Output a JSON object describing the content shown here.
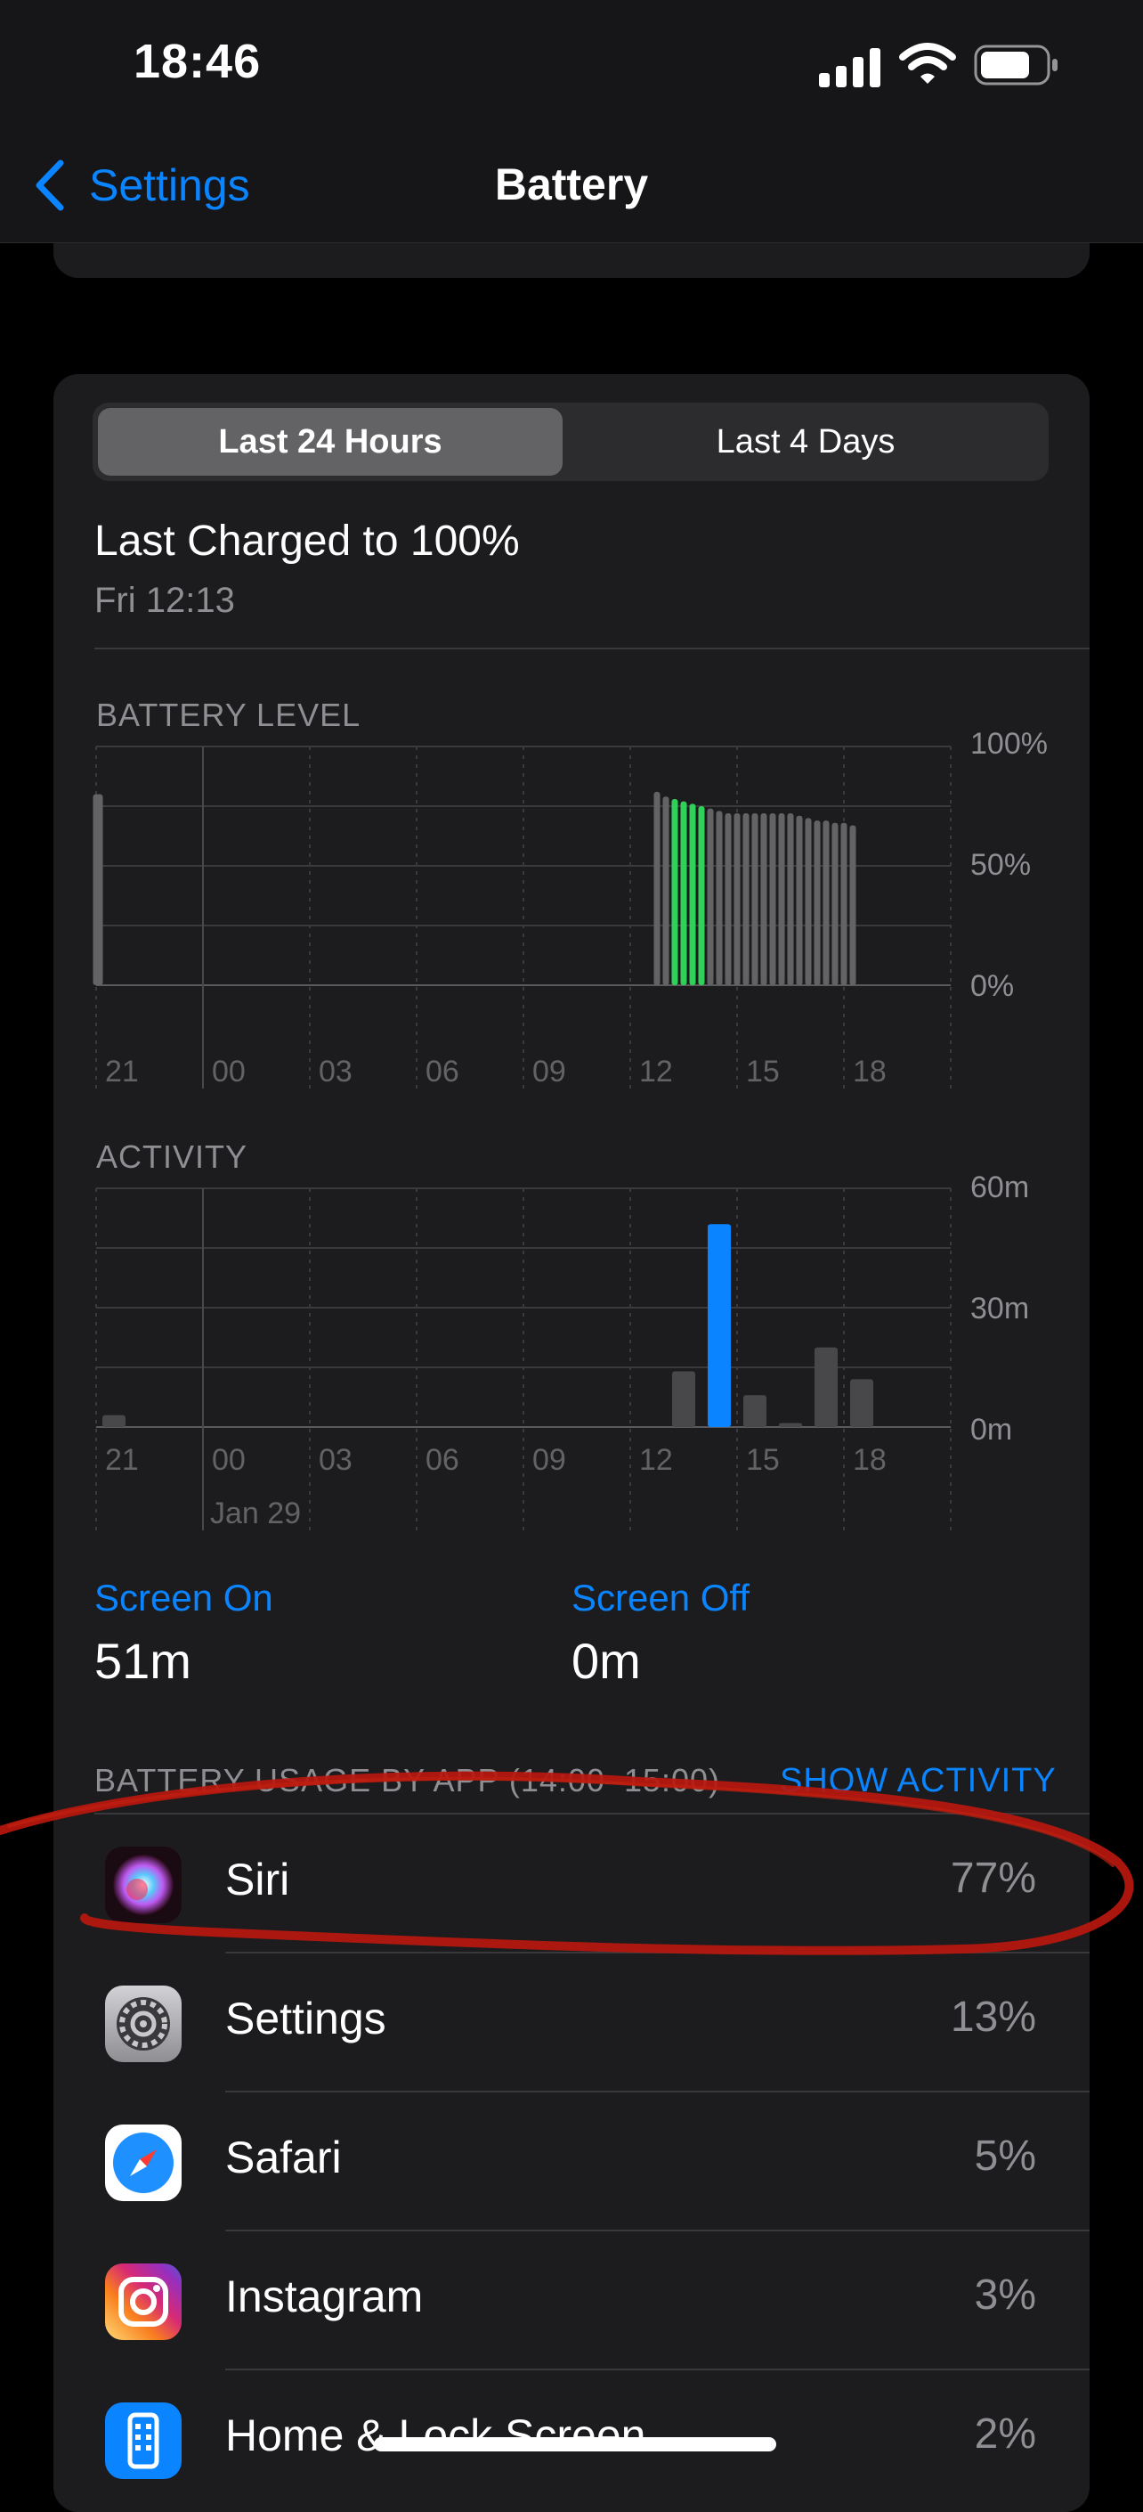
{
  "status_bar": {
    "time": "18:46",
    "icons": [
      "signal-icon",
      "wifi-icon",
      "battery-icon"
    ]
  },
  "nav": {
    "back_label": "Settings",
    "title": "Battery"
  },
  "segmented": {
    "options": [
      "Last 24 Hours",
      "Last 4 Days"
    ],
    "selected": "Last 24 Hours"
  },
  "last_charged": {
    "title": "Last Charged to 100%",
    "time": "Fri 12:13"
  },
  "battery_chart": {
    "label": "BATTERY LEVEL",
    "y_labels": [
      "100%",
      "50%",
      "0%"
    ],
    "x_labels": [
      "21",
      "00",
      "03",
      "06",
      "09",
      "12",
      "15",
      "18"
    ]
  },
  "activity_chart": {
    "label": "ACTIVITY",
    "y_labels": [
      "60m",
      "30m",
      "0m"
    ],
    "x_labels": [
      "21",
      "00",
      "03",
      "06",
      "09",
      "12",
      "15",
      "18"
    ],
    "date_label": "Jan 29"
  },
  "screen": {
    "on_label": "Screen On",
    "on_value": "51m",
    "off_label": "Screen Off",
    "off_value": "0m"
  },
  "usage": {
    "header": "BATTERY USAGE BY APP (14:00–15:00)",
    "show_activity": "SHOW ACTIVITY",
    "apps": [
      {
        "name": "Siri",
        "percent": "77%",
        "icon": "siri-icon"
      },
      {
        "name": "Settings",
        "percent": "13%",
        "icon": "settings-gear-icon"
      },
      {
        "name": "Safari",
        "percent": "5%",
        "icon": "safari-compass-icon"
      },
      {
        "name": "Instagram",
        "percent": "3%",
        "icon": "instagram-icon"
      },
      {
        "name": "Home & Lock Screen",
        "percent": "2%",
        "icon": "home-lock-screen-icon"
      }
    ]
  },
  "colors": {
    "accent": "#0a84ff",
    "charging": "#30d158",
    "annotation": "#b8180e"
  },
  "chart_data": [
    {
      "type": "bar",
      "title": "BATTERY LEVEL",
      "yunit": "%",
      "ylim": [
        0,
        100
      ],
      "y_ticks": [
        "0%",
        "50%",
        "100%"
      ],
      "x_ticks": [
        "21",
        "00",
        "03",
        "06",
        "09",
        "12",
        "15",
        "18"
      ],
      "x_hours": [
        21,
        21.05,
        21.1,
        12.75,
        13.0,
        13.25,
        13.5,
        13.75,
        14.0,
        14.25,
        14.5,
        14.75,
        15.0,
        15.25,
        15.5,
        15.75,
        16.0,
        16.25,
        16.5,
        16.75,
        17.0,
        17.25,
        17.5,
        17.75,
        18.0,
        18.25
      ],
      "values": [
        80,
        80,
        80,
        81,
        79,
        78,
        77,
        76,
        75,
        74,
        73,
        72,
        72,
        72,
        72,
        72,
        72,
        72,
        72,
        71,
        70,
        69,
        69,
        68,
        68,
        67
      ],
      "charging": [
        false,
        false,
        false,
        false,
        false,
        true,
        true,
        true,
        true,
        false,
        false,
        false,
        false,
        false,
        false,
        false,
        false,
        false,
        false,
        false,
        false,
        false,
        false,
        false,
        false,
        false
      ]
    },
    {
      "type": "bar",
      "title": "ACTIVITY",
      "ylim": [
        0,
        60
      ],
      "y_ticks": [
        "0m",
        "30m",
        "60m"
      ],
      "x_ticks": [
        "21",
        "00",
        "03",
        "06",
        "09",
        "12",
        "15",
        "18"
      ],
      "x_hours": [
        21,
        13,
        14,
        15,
        16,
        17,
        18
      ],
      "series": [
        {
          "name": "Screen On",
          "values": [
            3,
            0,
            51,
            0,
            0,
            0,
            0
          ]
        },
        {
          "name": "Screen Off",
          "values": [
            0,
            14,
            0,
            8,
            1,
            20,
            12
          ]
        }
      ]
    }
  ]
}
